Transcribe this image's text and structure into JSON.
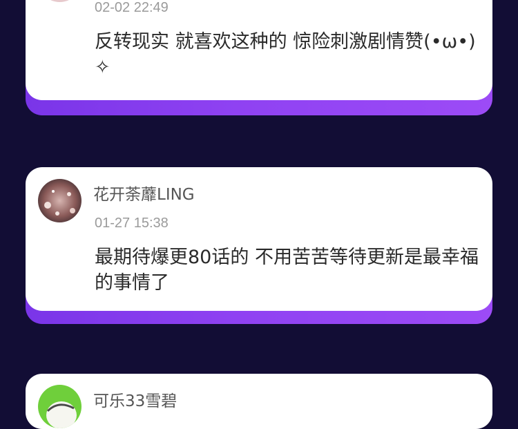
{
  "comments": [
    {
      "username": "",
      "time": "02-02 22:49",
      "text": "反转现实 就喜欢这种的 惊险刺激剧情赞(•ω•)✧",
      "avatar_icon": "pink-avatar-icon"
    },
    {
      "username": "花开荼蘼LING",
      "time": "01-27 15:38",
      "text": "最期待爆更80话的 不用苦苦等待更新是最幸福的事情了",
      "avatar_icon": "sparkle-photo-avatar-icon"
    },
    {
      "username": "可乐33雪碧",
      "time": "",
      "text": "",
      "avatar_icon": "green-cartoon-avatar-icon"
    }
  ],
  "colors": {
    "background": "#120d35",
    "card": "#ffffff",
    "accent_purple": "#8f42f2",
    "username": "#555555",
    "timestamp": "#9a9a9a",
    "text": "#2a2a2a"
  }
}
